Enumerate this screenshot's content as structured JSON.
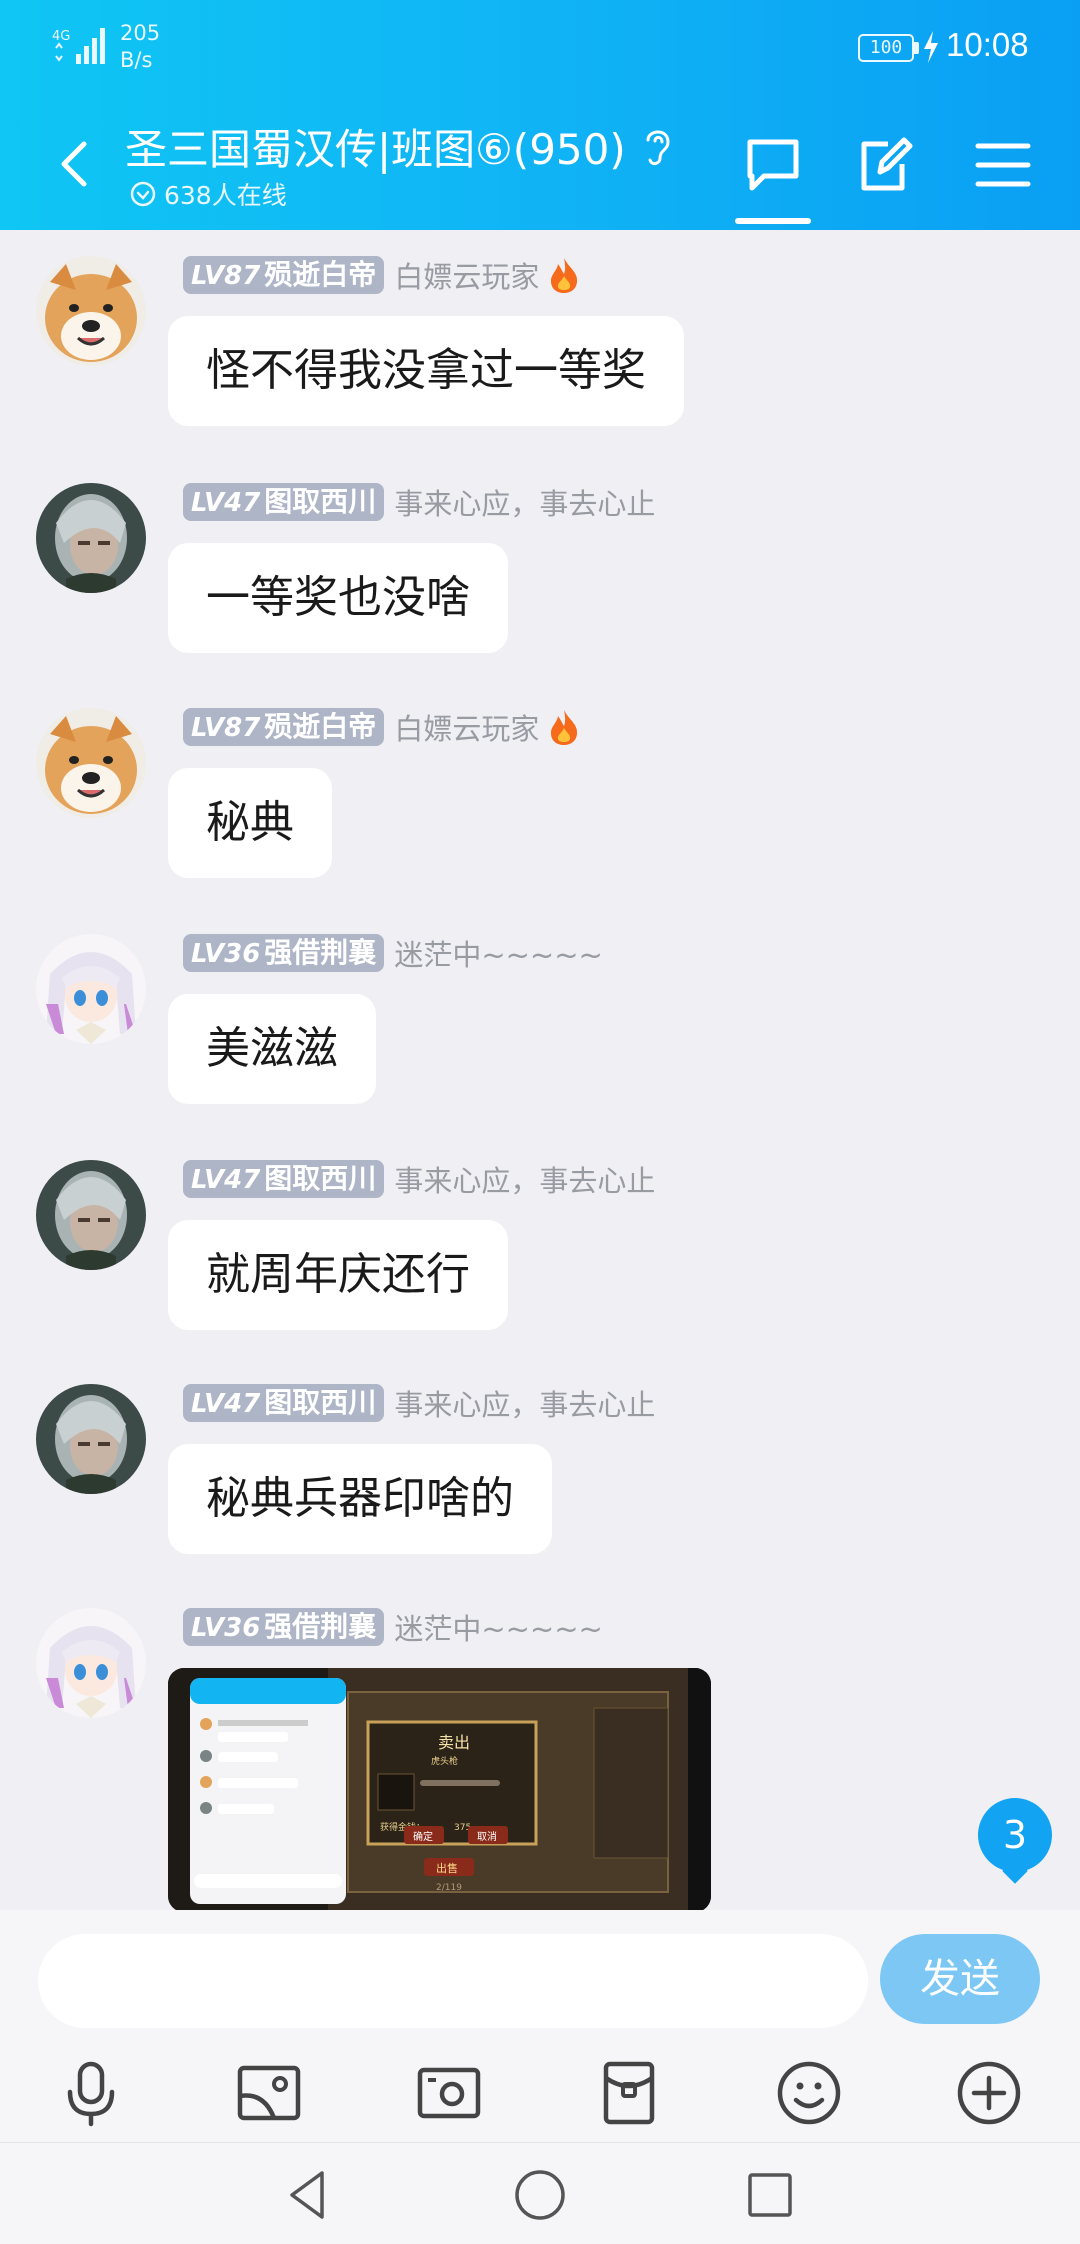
{
  "status_bar": {
    "network_type": "4G",
    "speed_value": "205",
    "speed_unit": "B/s",
    "battery": "100",
    "time": "10:08"
  },
  "header": {
    "group_name": "圣三国蜀汉传|班图⑥(950)",
    "online_count": "638人在线",
    "tabs": [
      "chat-icon",
      "edit-icon",
      "menu-icon"
    ],
    "accent_color": "#10b4f5"
  },
  "messages": [
    {
      "level": "LV87",
      "name": "殒逝白帝",
      "title": "白嫖云玩家",
      "fire": true,
      "text": "怪不得我没拿过一等奖",
      "avatar": "shiba-dog"
    },
    {
      "level": "LV47",
      "name": "图取西川",
      "title": "事来心应，事去心止",
      "fire": false,
      "text": "一等奖也没啥",
      "avatar": "silver-hair-man"
    },
    {
      "level": "LV87",
      "name": "殒逝白帝",
      "title": "白嫖云玩家",
      "fire": true,
      "text": "秘典",
      "avatar": "shiba-dog"
    },
    {
      "level": "LV36",
      "name": "强借荆襄",
      "title": "迷茫中~~~~~",
      "fire": false,
      "text": "美滋滋",
      "avatar": "anime-girl"
    },
    {
      "level": "LV47",
      "name": "图取西川",
      "title": "事来心应，事去心止",
      "fire": false,
      "text": "就周年庆还行",
      "avatar": "silver-hair-man"
    },
    {
      "level": "LV47",
      "name": "图取西川",
      "title": "事来心应，事去心止",
      "fire": false,
      "text": "秘典兵器印啥的",
      "avatar": "silver-hair-man"
    },
    {
      "level": "LV36",
      "name": "强借荆襄",
      "title": "迷茫中~~~~~",
      "fire": false,
      "text": "",
      "avatar": "anime-girl",
      "image": true
    }
  ],
  "image_preview": {
    "dialog_title": "卖出",
    "item_name": "虎头枪",
    "confirm": "确定",
    "cancel": "取消",
    "sell": "出售",
    "gold_label": "获得金钱：",
    "gold_value": "375",
    "page": "2/119"
  },
  "unread_badge": "3",
  "input": {
    "placeholder": "",
    "send_label": "发送"
  },
  "toolbar": [
    "microphone-icon",
    "image-icon",
    "camera-icon",
    "red-packet-icon",
    "emoji-icon",
    "plus-icon"
  ],
  "nav": [
    "back-triangle-icon",
    "home-circle-icon",
    "recents-square-icon"
  ]
}
